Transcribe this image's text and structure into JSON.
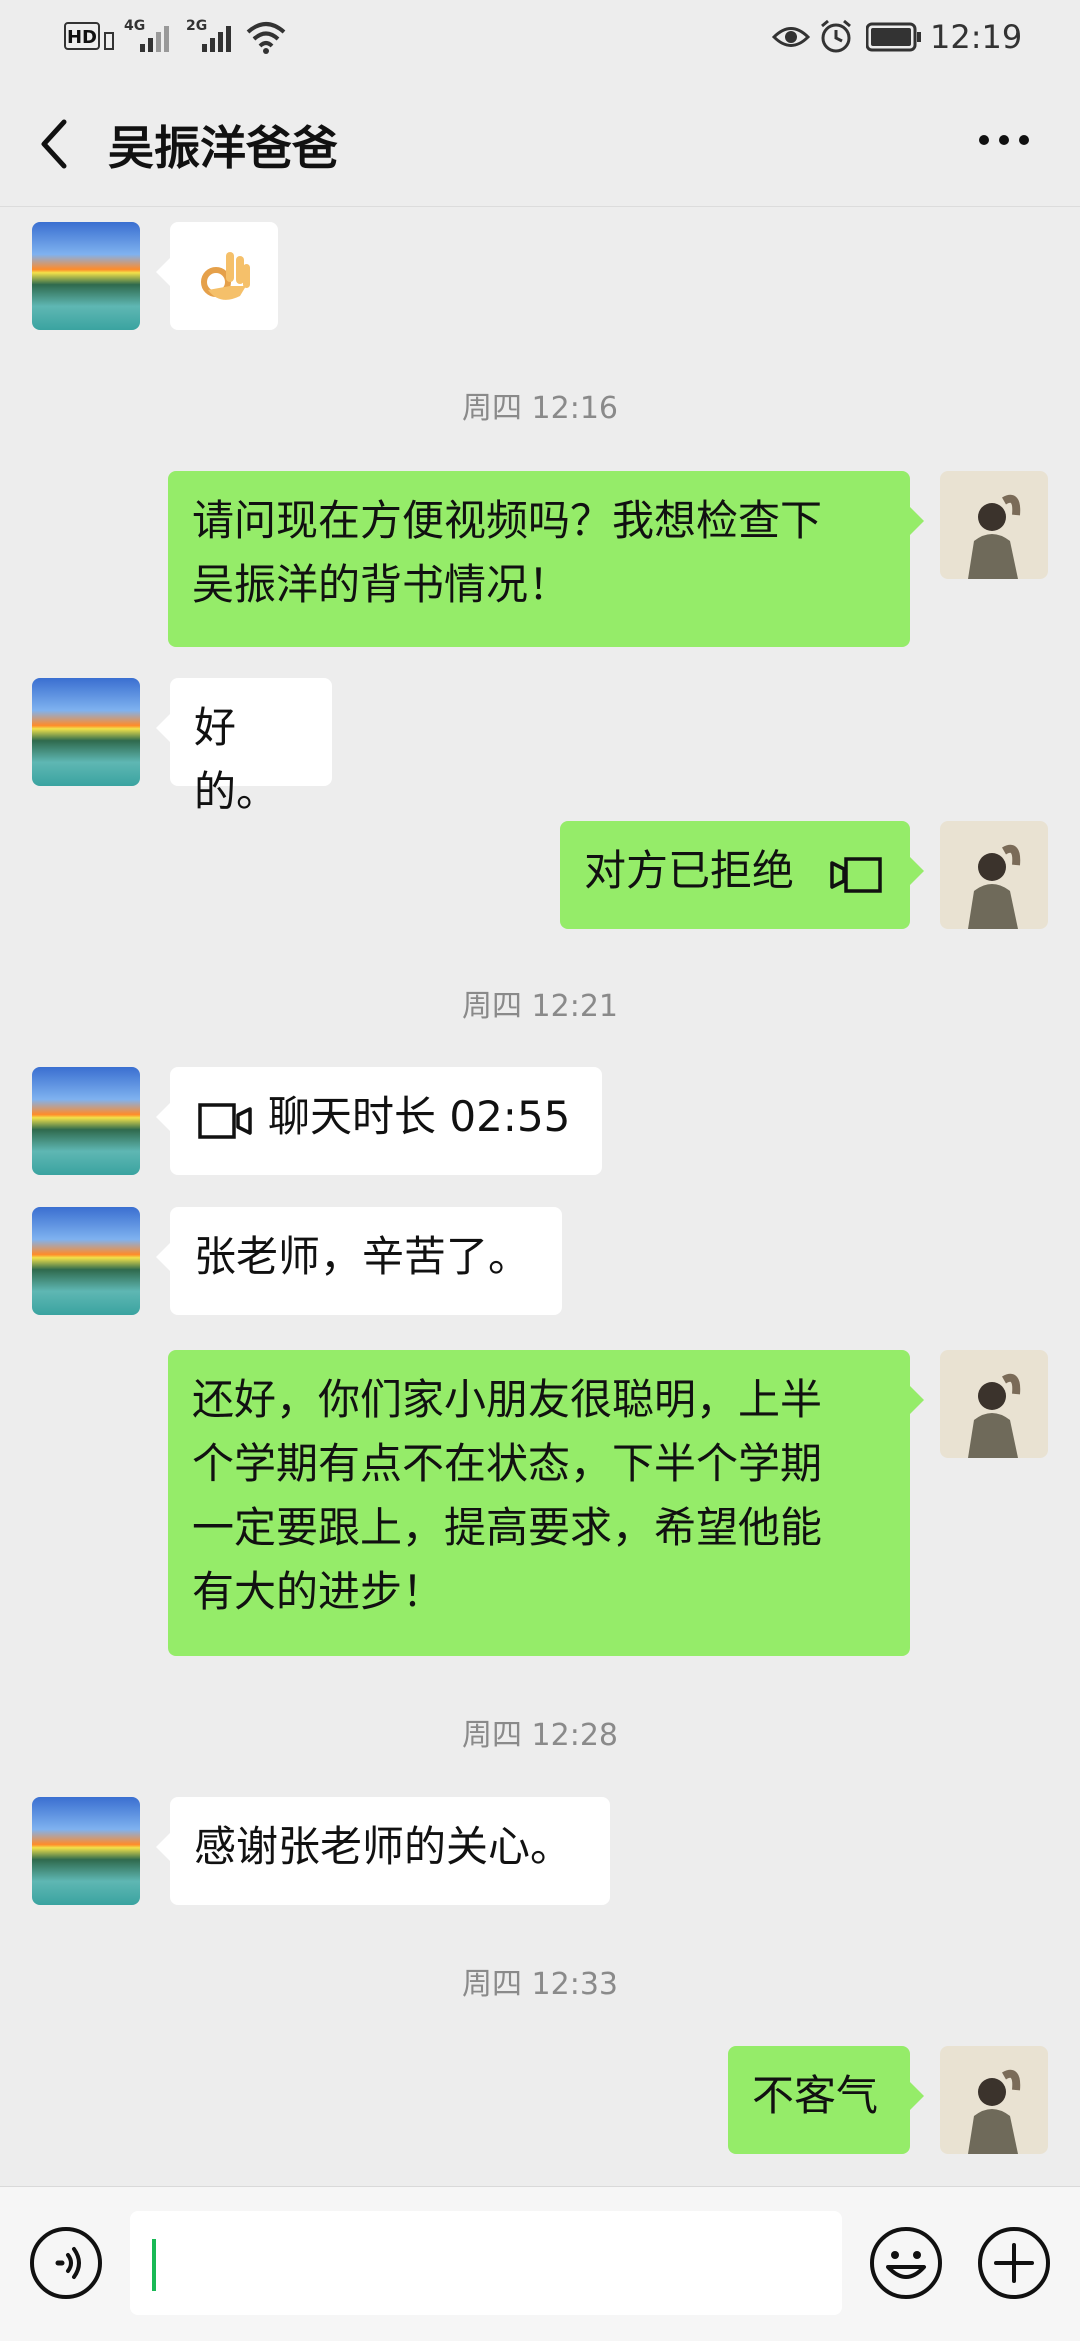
{
  "status_bar": {
    "network_left": "HD",
    "signal1_label": "4G",
    "signal2_label": "2G",
    "time": "12:19"
  },
  "header": {
    "back_icon": "chevron-left-icon",
    "title": "吴振洋爸爸",
    "more_icon": "more-dots-icon"
  },
  "messages": [
    {
      "type": "in",
      "content": "👌"
    },
    {
      "type": "time",
      "text": "周四 12:16"
    },
    {
      "type": "out",
      "lines": [
        "请问现在方便视频吗？我想检查下",
        "吴振洋的背书情况！"
      ]
    },
    {
      "type": "in",
      "text": "好的。"
    },
    {
      "type": "out",
      "text": "对方已拒绝",
      "icon": "video-call-icon"
    },
    {
      "type": "time",
      "text": "周四 12:21"
    },
    {
      "type": "in",
      "text": "聊天时长 02:55",
      "icon": "video-call-icon"
    },
    {
      "type": "in",
      "text": "张老师，辛苦了。"
    },
    {
      "type": "out",
      "lines": [
        "还好，你们家小朋友很聪明，上半",
        "个学期有点不在状态，下半个学期",
        "一定要跟上，提高要求，希望他能",
        "有大的进步！"
      ]
    },
    {
      "type": "time",
      "text": "周四 12:28"
    },
    {
      "type": "in",
      "text": "感谢张老师的关心。"
    },
    {
      "type": "time",
      "text": "周四 12:33"
    },
    {
      "type": "out",
      "text": "不客气"
    }
  ],
  "input_bar": {
    "voice_icon": "voice-icon",
    "emoji_icon": "emoji-icon",
    "plus_icon": "plus-icon",
    "input_value": ""
  },
  "colors": {
    "background": "#ededed",
    "outgoing_bubble": "#95ec69",
    "incoming_bubble": "#ffffff",
    "cursor": "#19b955"
  }
}
